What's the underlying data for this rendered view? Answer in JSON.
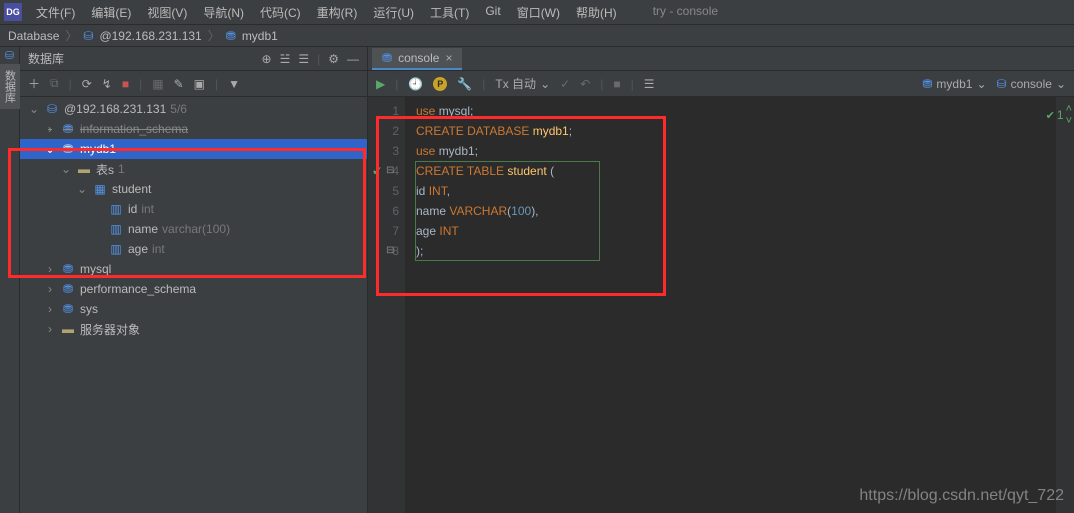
{
  "titlebar": {
    "logo": "DG",
    "project": "try - console"
  },
  "menu": [
    "文件(F)",
    "编辑(E)",
    "视图(V)",
    "导航(N)",
    "代码(C)",
    "重构(R)",
    "运行(U)",
    "工具(T)",
    "Git",
    "窗口(W)",
    "帮助(H)"
  ],
  "breadcrumb": {
    "parts": [
      "Database",
      "@192.168.231.131",
      "mydb1"
    ]
  },
  "sidebar": {
    "tab": "数据库"
  },
  "dbpanel": {
    "title": "数据库"
  },
  "tree": {
    "root": {
      "label": "@192.168.231.131",
      "badge": "5/6"
    },
    "info_schema": "information_schema",
    "mydb1": "mydb1",
    "tables": {
      "label": "表s",
      "count": "1"
    },
    "student": "student",
    "cols": [
      {
        "name": "id",
        "type": "int"
      },
      {
        "name": "name",
        "type": "varchar(100)"
      },
      {
        "name": "age",
        "type": "int"
      }
    ],
    "mysql": "mysql",
    "perf": "performance_schema",
    "sys": "sys",
    "server": "服务器对象"
  },
  "tab": {
    "label": "console"
  },
  "edtoolbar": {
    "tx": "Tx 自动",
    "dd1": "mydb1",
    "dd2": "console"
  },
  "code": {
    "lines": [
      {
        "n": "1",
        "tokens": [
          {
            "t": "use ",
            "c": "kw"
          },
          {
            "t": "mysql",
            "c": "id"
          },
          {
            "t": ";",
            "c": "id"
          }
        ]
      },
      {
        "n": "2",
        "tokens": [
          {
            "t": "CREATE DATABASE ",
            "c": "kw"
          },
          {
            "t": "mydb1",
            "c": "fn"
          },
          {
            "t": ";",
            "c": "id"
          }
        ]
      },
      {
        "n": "3",
        "tokens": [
          {
            "t": "use ",
            "c": "kw"
          },
          {
            "t": "mydb1",
            "c": "id"
          },
          {
            "t": ";",
            "c": "id"
          }
        ]
      },
      {
        "n": "4",
        "tokens": [
          {
            "t": "CREATE TABLE ",
            "c": "kw"
          },
          {
            "t": "student",
            "c": "fn"
          },
          {
            "t": " (",
            "c": "id"
          }
        ]
      },
      {
        "n": "5",
        "tokens": [
          {
            "t": "id ",
            "c": "id"
          },
          {
            "t": "INT",
            "c": "ty"
          },
          {
            "t": ",",
            "c": "id"
          }
        ]
      },
      {
        "n": "6",
        "tokens": [
          {
            "t": "name ",
            "c": "id"
          },
          {
            "t": "VARCHAR",
            "c": "ty"
          },
          {
            "t": "(",
            "c": "id"
          },
          {
            "t": "100",
            "c": "num"
          },
          {
            "t": "),",
            "c": "id"
          }
        ]
      },
      {
        "n": "7",
        "tokens": [
          {
            "t": "age ",
            "c": "id"
          },
          {
            "t": "INT",
            "c": "ty"
          }
        ]
      },
      {
        "n": "8",
        "tokens": [
          {
            "t": ");",
            "c": "id"
          }
        ]
      }
    ],
    "status": "1"
  },
  "watermark": "https://blog.csdn.net/qyt_722"
}
